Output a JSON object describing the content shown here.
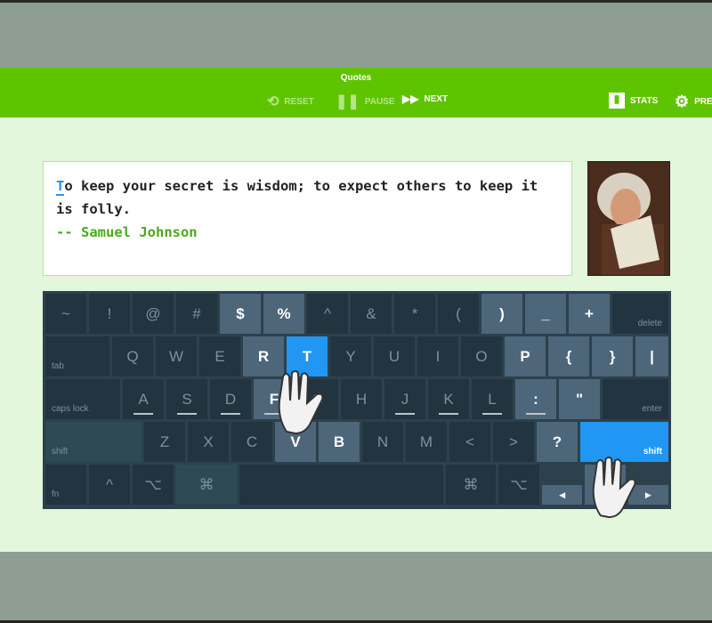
{
  "toolbar": {
    "title": "Quotes",
    "reset": "RESET",
    "pause": "PAUSE",
    "next": "NEXT",
    "stats": "STATS",
    "prefs": "PRE"
  },
  "quote": {
    "first_char": "T",
    "text_rest": "o keep your secret is wisdom; to expect others to keep it is folly.",
    "author": "-- Samuel Johnson"
  },
  "keyboard": {
    "row1": [
      "~",
      "!",
      "@",
      "#",
      "$",
      "%",
      "^",
      "&",
      "*",
      "(",
      ")",
      "_",
      "+"
    ],
    "delete": "delete",
    "tab": "tab",
    "row2": [
      "Q",
      "W",
      "E",
      "R",
      "T",
      "Y",
      "U",
      "I",
      "O",
      "P",
      "{",
      "}",
      "|"
    ],
    "caps": "caps lock",
    "row3": [
      "A",
      "S",
      "D",
      "F",
      "G",
      "H",
      "J",
      "K",
      "L",
      ":",
      "\""
    ],
    "enter": "enter",
    "shift": "shift",
    "row4": [
      "Z",
      "X",
      "C",
      "V",
      "B",
      "N",
      "M",
      "<",
      ">",
      "?"
    ],
    "shift_r": "shift",
    "fn": "fn",
    "ctrl": "^",
    "alt": "⌥",
    "cmd": "⌘",
    "cmd_r": "⌘",
    "alt_r": "⌥",
    "left": "◀",
    "up": "▲",
    "right": "▶",
    "highlighted": [
      "$",
      "%",
      ")",
      "_",
      "+",
      "R",
      "P",
      "{",
      "}",
      "|",
      "F",
      ":",
      "\"",
      "V",
      "B",
      "?"
    ],
    "active": [
      "T",
      "shift_r"
    ],
    "colors": {
      "active": "#2196f3",
      "highlight": "#4d667a",
      "key": "#22343f"
    }
  }
}
